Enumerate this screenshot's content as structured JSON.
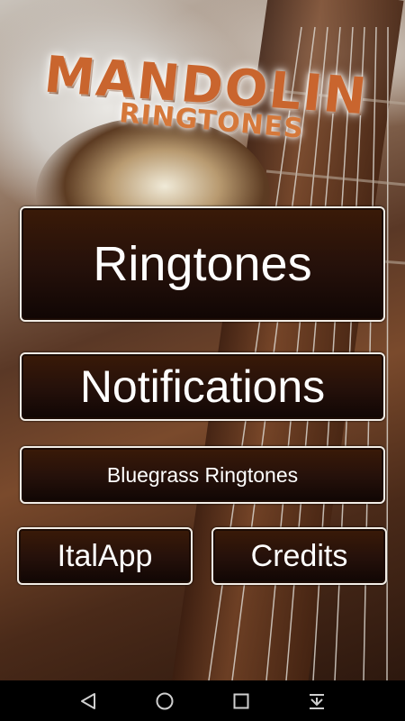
{
  "app": {
    "logo_line1": "MANDOLIN",
    "logo_line2": "RINGTONES"
  },
  "menu": {
    "ringtones_label": "Ringtones",
    "notifications_label": "Notifications",
    "bluegrass_label": "Bluegrass Ringtones",
    "italapp_label": "ItalApp",
    "credits_label": "Credits"
  },
  "navbar": {
    "back_icon": "back-triangle-icon",
    "home_icon": "home-circle-icon",
    "recents_icon": "recents-square-icon",
    "hide_icon": "hide-keyboard-icon"
  },
  "colors": {
    "button_border": "#f2ede6",
    "button_bg_top": "#3a1a08",
    "button_bg_bottom": "#100604",
    "logo_text": "#c9652e",
    "navbar_bg": "#000000"
  }
}
